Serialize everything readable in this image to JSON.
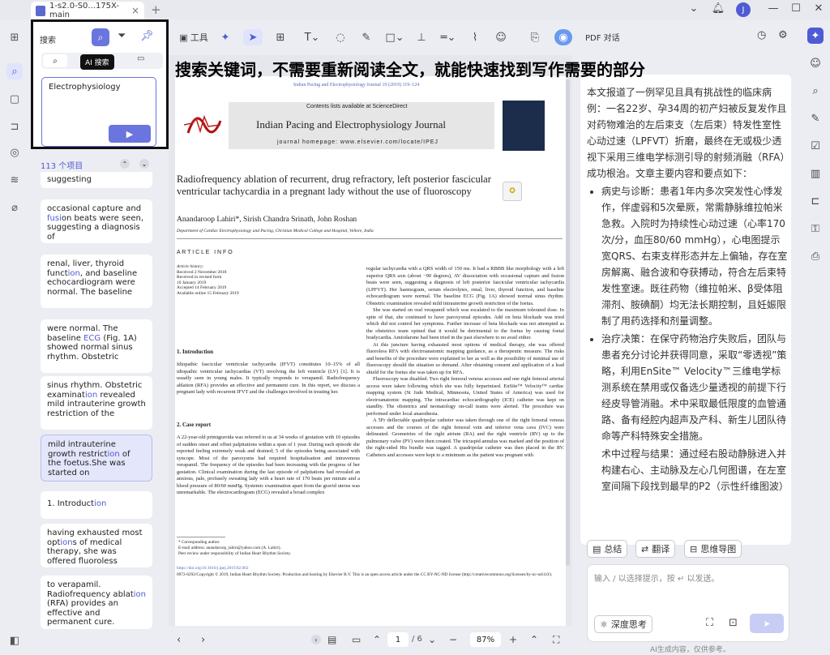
{
  "titlebar": {
    "tab_title": "1-s2.0-S0...175X-main",
    "tab_close": "×",
    "new_tab": "+",
    "avatar_letter": "J"
  },
  "search": {
    "header_label": "搜索",
    "tooltip": "AI 搜索",
    "query": "Electrophysiology",
    "send_label": "▶",
    "count_label": "113 个项目"
  },
  "results": [
    {
      "text": "suggesting"
    },
    {
      "pre": "occasional capture and ",
      "hl1": "fusi",
      "mid": "on beats were seen, suggesting a diagnosis of",
      "hl2": "",
      "post": ""
    },
    {
      "pre": "renal, liver, thyroid funct",
      "hl1": "ion",
      "mid": ", and baseline echocardiogram were normal. The baseline",
      "hl2": "",
      "post": ""
    },
    {
      "pre": "were normal. The baseline ",
      "hl1": "ECG",
      "mid": " (Fig. 1A) showed normal sinus rhythm. Obstetric",
      "hl2": "",
      "post": ""
    },
    {
      "pre": "sinus rhythm. Obstetric examinat",
      "hl1": "ion",
      "mid": " revealed mild intrauterine growth restriction of the",
      "hl2": "",
      "post": ""
    },
    {
      "pre": "mild intrauterine growth restrict",
      "hl1": "ion",
      "mid": " of the foetus.She was started on",
      "hl2": "",
      "post": ""
    },
    {
      "pre": "1. Introduct",
      "hl1": "ion",
      "mid": "",
      "hl2": "",
      "post": ""
    },
    {
      "pre": "having exhausted most opt",
      "hl1": "ion",
      "mid": "s of medical therapy, she was offered fluoroless",
      "hl2": "",
      "post": ""
    },
    {
      "pre": "to verapamil. Radiofrequency ablat",
      "hl1": "ion",
      "mid": " (RFA) provides an effective and permanent cure.",
      "hl2": "",
      "post": ""
    }
  ],
  "toolbar": {
    "tools_label": "工具"
  },
  "overlay_caption": "搜索关键词，不需要重新阅读全文，就能快速找到写作需要的部分",
  "paper": {
    "journal_line": "Indian Pacing and Electrophysiology Journal 19 (2019) 119–124",
    "contents": "Contents lists available at ScienceDirect",
    "journal_title": "Indian Pacing and Electrophysiology Journal",
    "homepage": "journal homepage: www.elsevier.com/locate/IPEJ",
    "title": "Radiofrequency ablation of recurrent, drug refractory, left posterior fascicular ventricular tachycardia in a pregnant lady without the use of fluoroscopy",
    "authors": "Anandaroop Lahiri*, Sirish Chandra Srinath, John Roshan",
    "affiliation": "Department of Cardiac Electrophysiology and Pacing, Christian Medical College and Hospital, Vellore, India",
    "article_info": "A R T I C L E   I N F O",
    "history": [
      "Article history:",
      "Received 2 November 2018",
      "Received in revised form",
      "10 January 2019",
      "Accepted 14 February 2019",
      "Available online 15 February 2019"
    ],
    "intro_heading": "1. Introduction",
    "intro_text": "Idiopathic fascicular ventricular tachycardia (IFVT) constitutes 10–15% of all idiopathic ventricular tachycardias (VT) involving the left ventricle (LV) [1]. It is usually seen in young males. It typically responds to verapamil. Radiofrequency ablation (RFA) provides an effective and permanent cure. In this report, we discuss a pregnant lady with recurrent IFVT and the challenges involved in treating her.",
    "case_heading": "2. Case report",
    "case_text": "A 22-year-old primigravida was referred to us at 34 weeks of gestation with 10 episodes of sudden onset and offset palpitations within a span of 1 year. During each episode she reported feeling extremely weak and drained; 5 of the episodes being associated with syncope. Most of the paroxysms had required hospitalisation and intravenous verapamil. The frequency of the episodes had been increasing with the progress of her gestation. Clinical examination during the last episode of palpitations had revealed an anxious, pale, profusely sweating lady with a heart rate of 170 beats per minute and a blood pressure of 80/60 mmHg. Systemic examination apart from the gravid uterus was unremarkable. The electrocardiogram (ECG) revealed a broad complex",
    "right_col_1": "regular tachycardia with a QRS width of 150 ms. It had a RBBB like morphology with a left superior QRS axis (about −90 degrees), AV dissociation with occasional capture and fusion beats were seen, suggesting a diagnosis of left posterior fascicular ventricular tachycardia (LPFVT). Her haemogram, serum electrolytes, renal, liver, thyroid function, and baseline echocardiogram were normal. The baseline ECG (Fig. 1A) showed normal sinus rhythm. Obstetric examination revealed mild intrauterine growth restriction of the foetus.",
    "right_col_2": "She was started on oral verapamil which was escalated to the maximum tolerated dose. In spite of that, she continued to have paroxysmal episodes. Add on beta blockade was tried which did not control her symptoms. Further increase of beta blockade was not attempted as the obstetrics team opined that it would be detrimental to the foetus by causing foetal bradycardia. Amiodarone had been tried in the past elsewhere to no avail either.",
    "right_col_3": "At this juncture having exhausted most options of medical therapy, she was offered fluoroless RFA with electroanatomic mapping guidance, as a therapeutic measure. The risks and benefits of the procedure were explained to her as well as the possibility of minimal use of fluoroscopy should the situation so demand. After obtaining consent and application of a lead shield for the foetus she was taken up for RFA.",
    "right_col_4": "Fluoroscopy was disabled. Two right femoral venous accesses and one right femoral arterial access were taken following which she was fully heparinised. EnSite™ Velocity™ cardiac mapping system (St Jude Medical, Minnesota, United States of America) was used for electroanatomic mapping. The intracardiac echocardiography (ICE) catheter was kept on standby. The obstetrics and neonatology on-call teams were alerted. The procedure was performed under local anaesthesia.",
    "right_col_5": "A 5Fr deflectable quadripolar catheter was taken through one of the right femoral venous accesses and the courses of the right femoral vein and inferior vena cava (IVC) were delineated. Geometries of the right atrium (RA) and the right ventricle (RV) up to the pulmonary valve (PV) were then created. The tricuspid annulus was marked and the position of the right-sided His bundle was tagged. A quadripolar catheter was then placed in the RV. Catheters and accesses were kept to a minimum as the patient was pregnant with",
    "footnote_1": "* Corresponding author.",
    "footnote_2": "E-mail address: anandaroop_lahiri@yahoo.com (A. Lahiri).",
    "footnote_3": "Peer review under responsibility of Indian Heart Rhythm Society.",
    "doi": "https://doi.org/10.1016/j.ipej.2019.02.002",
    "copyright": "0972-6292/Copyright © 2019, Indian Heart Rhythm Society. Production and hosting by Elsevier B.V. This is an open access article under the CC BY-NC-ND license (http://creativecommons.org/licenses/by-nc-nd/4.0/)."
  },
  "pager": {
    "current": "1",
    "total": "/ 6",
    "zoom": "87%"
  },
  "ai": {
    "header": "PDF 对话",
    "intro": "本文报道了一例罕见且具有挑战性的临床病例：一名22岁、孕34周的初产妇被反复发作且对药物难治的左后束支（左后束）特发性室性心动过速（LPFVT）折磨，最终在无或极少透视下采用三维电学标测引导的射频消融（RFA）成功根治。文章主要内容和要点如下：",
    "bullets": [
      "病史与诊断：患者1年内多次突发性心悸发作，伴虚弱和5次晕厥，常需静脉维拉帕米急救。入院时为持续性心动过速（心率170次/分，血压80/60 mmHg），心电图提示宽QRS、右束支样形态并左上偏轴，存在室房解离、融合波和夺获搏动，符合左后束特发性室速。既往药物（维拉帕米、β受体阻滞剂、胺碘酮）均无法长期控制，且妊娠限制了用药选择和剂量调整。",
      "治疗决策：在保守药物治疗失败后，团队与患者充分讨论并获得同意，采取“零透视”策略，利用EnSite™ Velocity™三维电学标测系统在禁用或仅备选少量透视的前提下行经皮导管消融。术中采取最低限度的血管通路、备有经腔内超声及产科、新生儿团队待命等产科特殊安全措施。",
      "术中过程与结果：通过经右股动静脉进入并构建右心、主动脉及左心几何图谱，在左室室间隔下段找到最早的P2（示性纤维图波）电位并行激活映射与隐匿性诱捕验"
    ],
    "btn_summary": "总结",
    "btn_translate": "翻译",
    "btn_mindmap": "思维导图",
    "input_placeholder": "输入 / 以选择提示，按 ↵ 以发送。",
    "deep_think": "深度思考",
    "disclaimer": "AI生成内容，仅供参考。"
  },
  "colors": {
    "accent": "#4f5bd5",
    "highlight_bg": "#c9d3ff",
    "selected_card": "#e4e6fb"
  }
}
